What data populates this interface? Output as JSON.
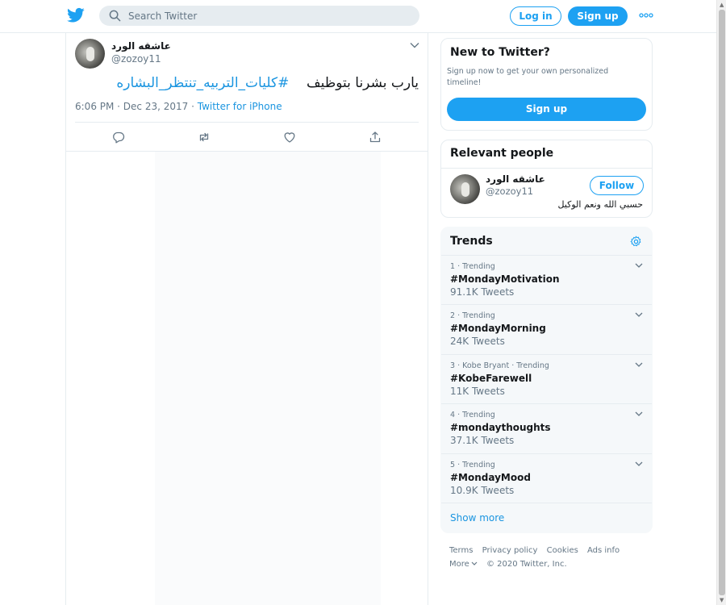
{
  "header": {
    "search_placeholder": "Search Twitter",
    "login_label": "Log in",
    "signup_label": "Sign up",
    "brand_color": "#1da1f2"
  },
  "tweet": {
    "display_name": "عاشقه الورد",
    "handle": "@zozoy11",
    "text": "يارب بشرنا بتوظيف",
    "hashtag": "#كليات_التربيه_تنتظر_البشاره",
    "timestamp": "6:06 PM · Dec 23, 2017",
    "separator": " · ",
    "source": "Twitter for iPhone",
    "actions": [
      "reply-icon",
      "retweet-icon",
      "like-icon",
      "share-icon"
    ]
  },
  "new_to_twitter": {
    "title": "New to Twitter?",
    "body": "Sign up now to get your own personalized timeline!",
    "button": "Sign up"
  },
  "relevant_people": {
    "title": "Relevant people",
    "person": {
      "display_name": "عاشقه الورد",
      "handle": "@zozoy11",
      "follow_label": "Follow",
      "bio": "حسبي الله ونعم الوكيل"
    }
  },
  "trends": {
    "title": "Trends",
    "items": [
      {
        "meta": "1 · Trending",
        "name": "#MondayMotivation",
        "count": "91.1K Tweets"
      },
      {
        "meta": "2 · Trending",
        "name": "#MondayMorning",
        "count": "24K Tweets"
      },
      {
        "meta": "3 · Kobe Bryant · Trending",
        "name": "#KobeFarewell",
        "count": "11K Tweets"
      },
      {
        "meta": "4 · Trending",
        "name": "#mondaythoughts",
        "count": "37.1K Tweets"
      },
      {
        "meta": "5 · Trending",
        "name": "#MondayMood",
        "count": "10.9K Tweets"
      }
    ],
    "show_more": "Show more"
  },
  "footer": {
    "links": [
      "Terms",
      "Privacy policy",
      "Cookies",
      "Ads info"
    ],
    "more": "More",
    "copyright": "© 2020 Twitter, Inc."
  }
}
